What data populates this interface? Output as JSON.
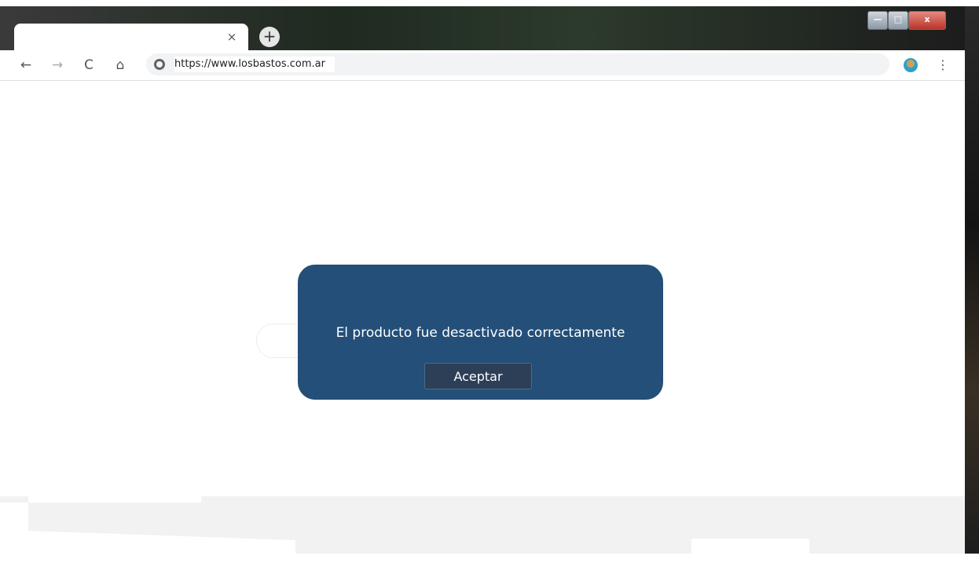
{
  "browser": {
    "tab": {
      "title": "",
      "close_glyph": "×"
    },
    "new_tab_glyph": "+",
    "window_controls": {
      "minimize_glyph": "—",
      "maximize_glyph": "□",
      "close_glyph": "x"
    },
    "nav": {
      "back_glyph": "←",
      "forward_glyph": "→",
      "reload_glyph": "C",
      "home_glyph": "⌂"
    },
    "url": "https://www.losbastos.com.ar",
    "menu_glyph": "⋮"
  },
  "modal": {
    "message": "El producto fue desactivado correctamente",
    "accept_label": "Aceptar",
    "background_color": "#234f78",
    "button_color": "#2d3f57"
  },
  "icons": [
    "close-icon",
    "plus-icon",
    "back-arrow-icon",
    "forward-arrow-icon",
    "reload-icon",
    "home-icon",
    "globe-icon",
    "profile-avatar-icon",
    "menu-dots-icon"
  ]
}
